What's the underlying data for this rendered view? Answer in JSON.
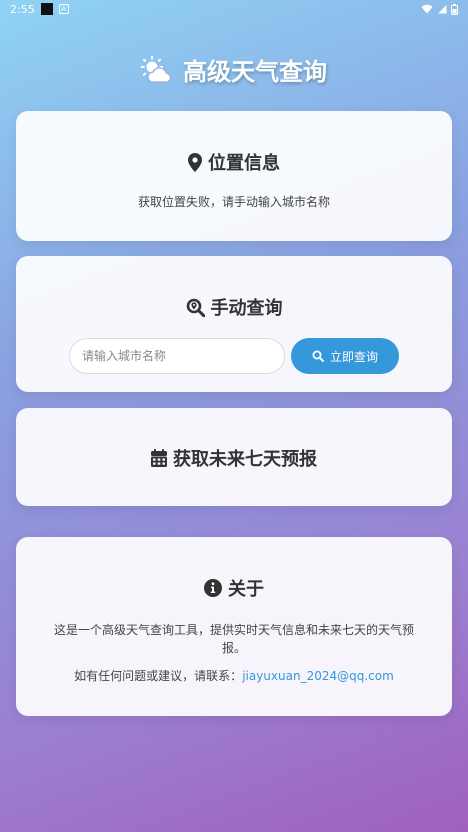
{
  "status_bar": {
    "time": "2:55",
    "a_badge": "A"
  },
  "app": {
    "title": "高级天气查询"
  },
  "location_card": {
    "title": "位置信息",
    "message": "获取位置失败，请手动输入城市名称"
  },
  "manual_card": {
    "title": "手动查询",
    "input_placeholder": "请输入城市名称",
    "input_value": "",
    "button_label": "立即查询"
  },
  "forecast_card": {
    "title": "获取未来七天预报"
  },
  "about_card": {
    "title": "关于",
    "description": "这是一个高级天气查询工具，提供实时天气信息和未来七天的天气预报。",
    "contact_prefix": "如有任何问题或建议，请联系：",
    "email": "jiayuxuan_2024@qq.com"
  },
  "icons": {
    "title": "weather-sun-cloud-icon",
    "location": "map-marker-icon",
    "manual": "search-location-icon",
    "button": "search-icon",
    "forecast": "calendar-icon",
    "about": "info-circle-icon"
  },
  "colors": {
    "accent": "#3498db",
    "card_bg": "#f7f7fb",
    "title_text": "#ffffff",
    "heading_text": "#333333"
  }
}
